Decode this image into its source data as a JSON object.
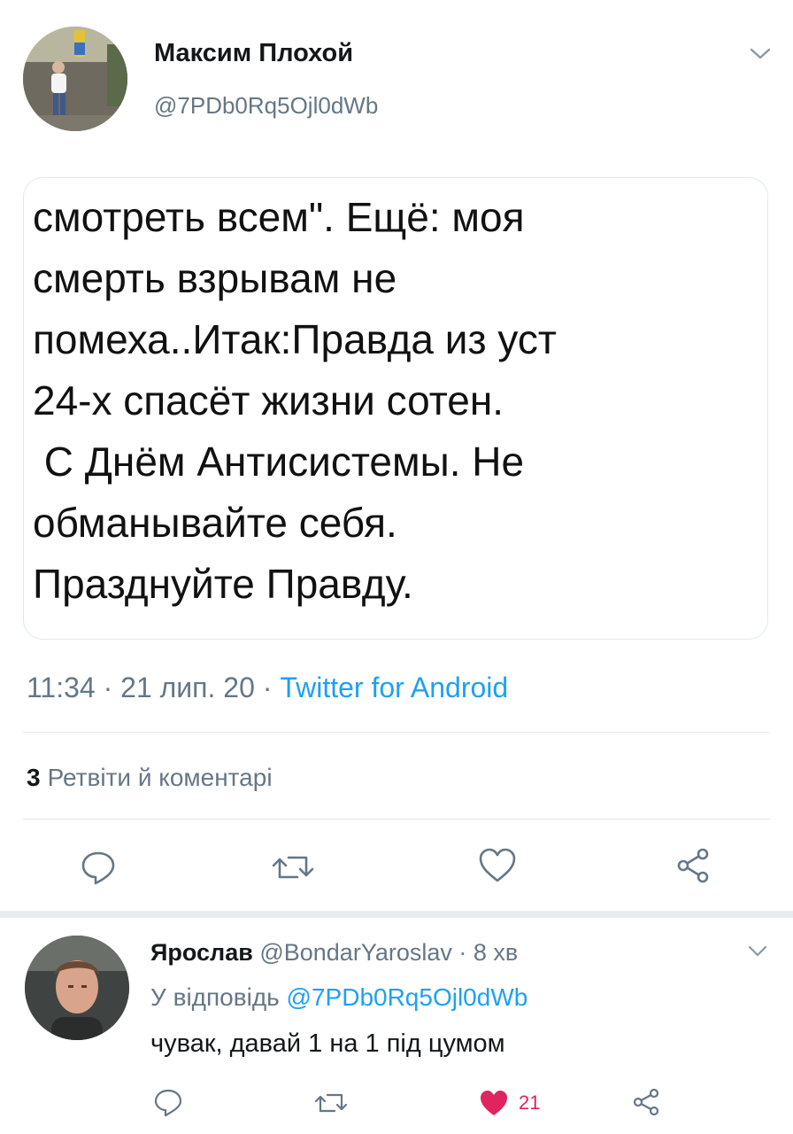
{
  "tweet": {
    "author_name": "Максим Плохой",
    "author_handle": "@7PDb0Rq5Ojl0dWb",
    "quoted_text": "смотреть всем\". Ещё: моя\nсмерть взрывам не\nпомеха..Итак:Правда из уст\n24-х спасёт жизни сотен.\n С Днём Антисистемы. Не\nобманывайте себя.\nПразднуйте Правду.",
    "time": "11:34",
    "date": "21 лип. 20",
    "separator": "·",
    "source": "Twitter for Android",
    "retweet_count": "3",
    "retweet_label": "Ретвіти й коментарі"
  },
  "reply": {
    "author_name": "Ярослав",
    "author_handle": "@BondarYaroslav",
    "separator": "·",
    "time": "8 хв",
    "replying_to_label": "У відповідь",
    "replying_to_handle": "@7PDb0Rq5Ojl0dWb",
    "text": "чувак, давай 1 на 1 під цумом",
    "like_count": "21"
  },
  "colors": {
    "accent": "#1da1f2",
    "muted": "#657786",
    "like": "#e0245e",
    "divider": "#e1e8ed"
  },
  "icons": [
    "chevron-down-icon",
    "reply-icon",
    "retweet-icon",
    "like-icon",
    "share-icon"
  ]
}
